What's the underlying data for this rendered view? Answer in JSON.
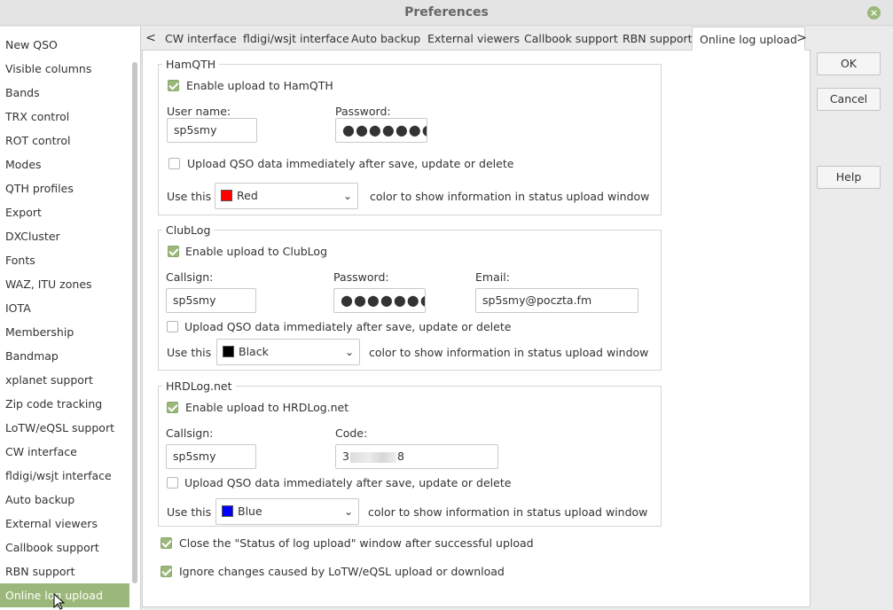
{
  "window": {
    "title": "Preferences"
  },
  "sidebar": {
    "items": [
      "New QSO",
      "Visible columns",
      "Bands",
      "TRX control",
      "ROT control",
      "Modes",
      "QTH profiles",
      "Export",
      "DXCluster",
      "Fonts",
      "WAZ, ITU zones",
      "IOTA",
      "Membership",
      "Bandmap",
      "xplanet support",
      "Zip code tracking",
      "LoTW/eQSL support",
      "CW interface",
      "fldigi/wsjt interface",
      "Auto backup",
      "External viewers",
      "Callbook support",
      "RBN support",
      "Online log upload"
    ],
    "selected_index": 23
  },
  "tabs": {
    "items": [
      "CW interface",
      "fldigi/wsjt interface",
      "Auto backup",
      "External viewers",
      "Callbook support",
      "RBN support",
      "Online log upload"
    ],
    "active_index": 6,
    "left_arrow": "<",
    "right_arrow": ">"
  },
  "hamqth": {
    "legend": "HamQTH",
    "enable_label": "Enable upload to HamQTH",
    "enable_checked": true,
    "user_label": "User name:",
    "user_value": "sp5smy",
    "password_label": "Password:",
    "password_value": "●●●●●●●●●",
    "immediate_label": "Upload QSO data immediately after save, update or delete",
    "immediate_checked": false,
    "use_this": "Use this",
    "color_name": "Red",
    "color_hex": "#ff0000",
    "color_suffix": "color to show information in status upload window"
  },
  "clublog": {
    "legend": "ClubLog",
    "enable_label": "Enable upload to ClubLog",
    "enable_checked": true,
    "call_label": "Callsign:",
    "call_value": "sp5smy",
    "password_label": "Password:",
    "password_value": "●●●●●●●●●",
    "email_label": "Email:",
    "email_value": "sp5smy@poczta.fm",
    "immediate_label": "Upload QSO data immediately after save, update or delete",
    "immediate_checked": false,
    "use_this": "Use this",
    "color_name": "Black",
    "color_hex": "#000000",
    "color_suffix": "color to show information in status upload window"
  },
  "hrdlog": {
    "legend": "HRDLog.net",
    "enable_label": "Enable upload to HRDLog.net",
    "enable_checked": true,
    "call_label": "Callsign:",
    "call_value": "sp5smy",
    "code_label": "Code:",
    "code_start": "3",
    "code_end": "8",
    "immediate_label": "Upload QSO data immediately after save, update or delete",
    "immediate_checked": false,
    "use_this": "Use this",
    "color_name": "Blue",
    "color_hex": "#0000ff",
    "color_suffix": "color to show information in status upload window"
  },
  "options": {
    "close_status_label": "Close the \"Status of log upload\" window after successful upload",
    "close_status_checked": true,
    "ignore_label": "Ignore changes caused by LoTW/eQSL upload or download",
    "ignore_checked": true
  },
  "buttons": {
    "ok": "OK",
    "cancel": "Cancel",
    "help": "Help"
  },
  "colors": {
    "accent": "#9bb87a"
  }
}
